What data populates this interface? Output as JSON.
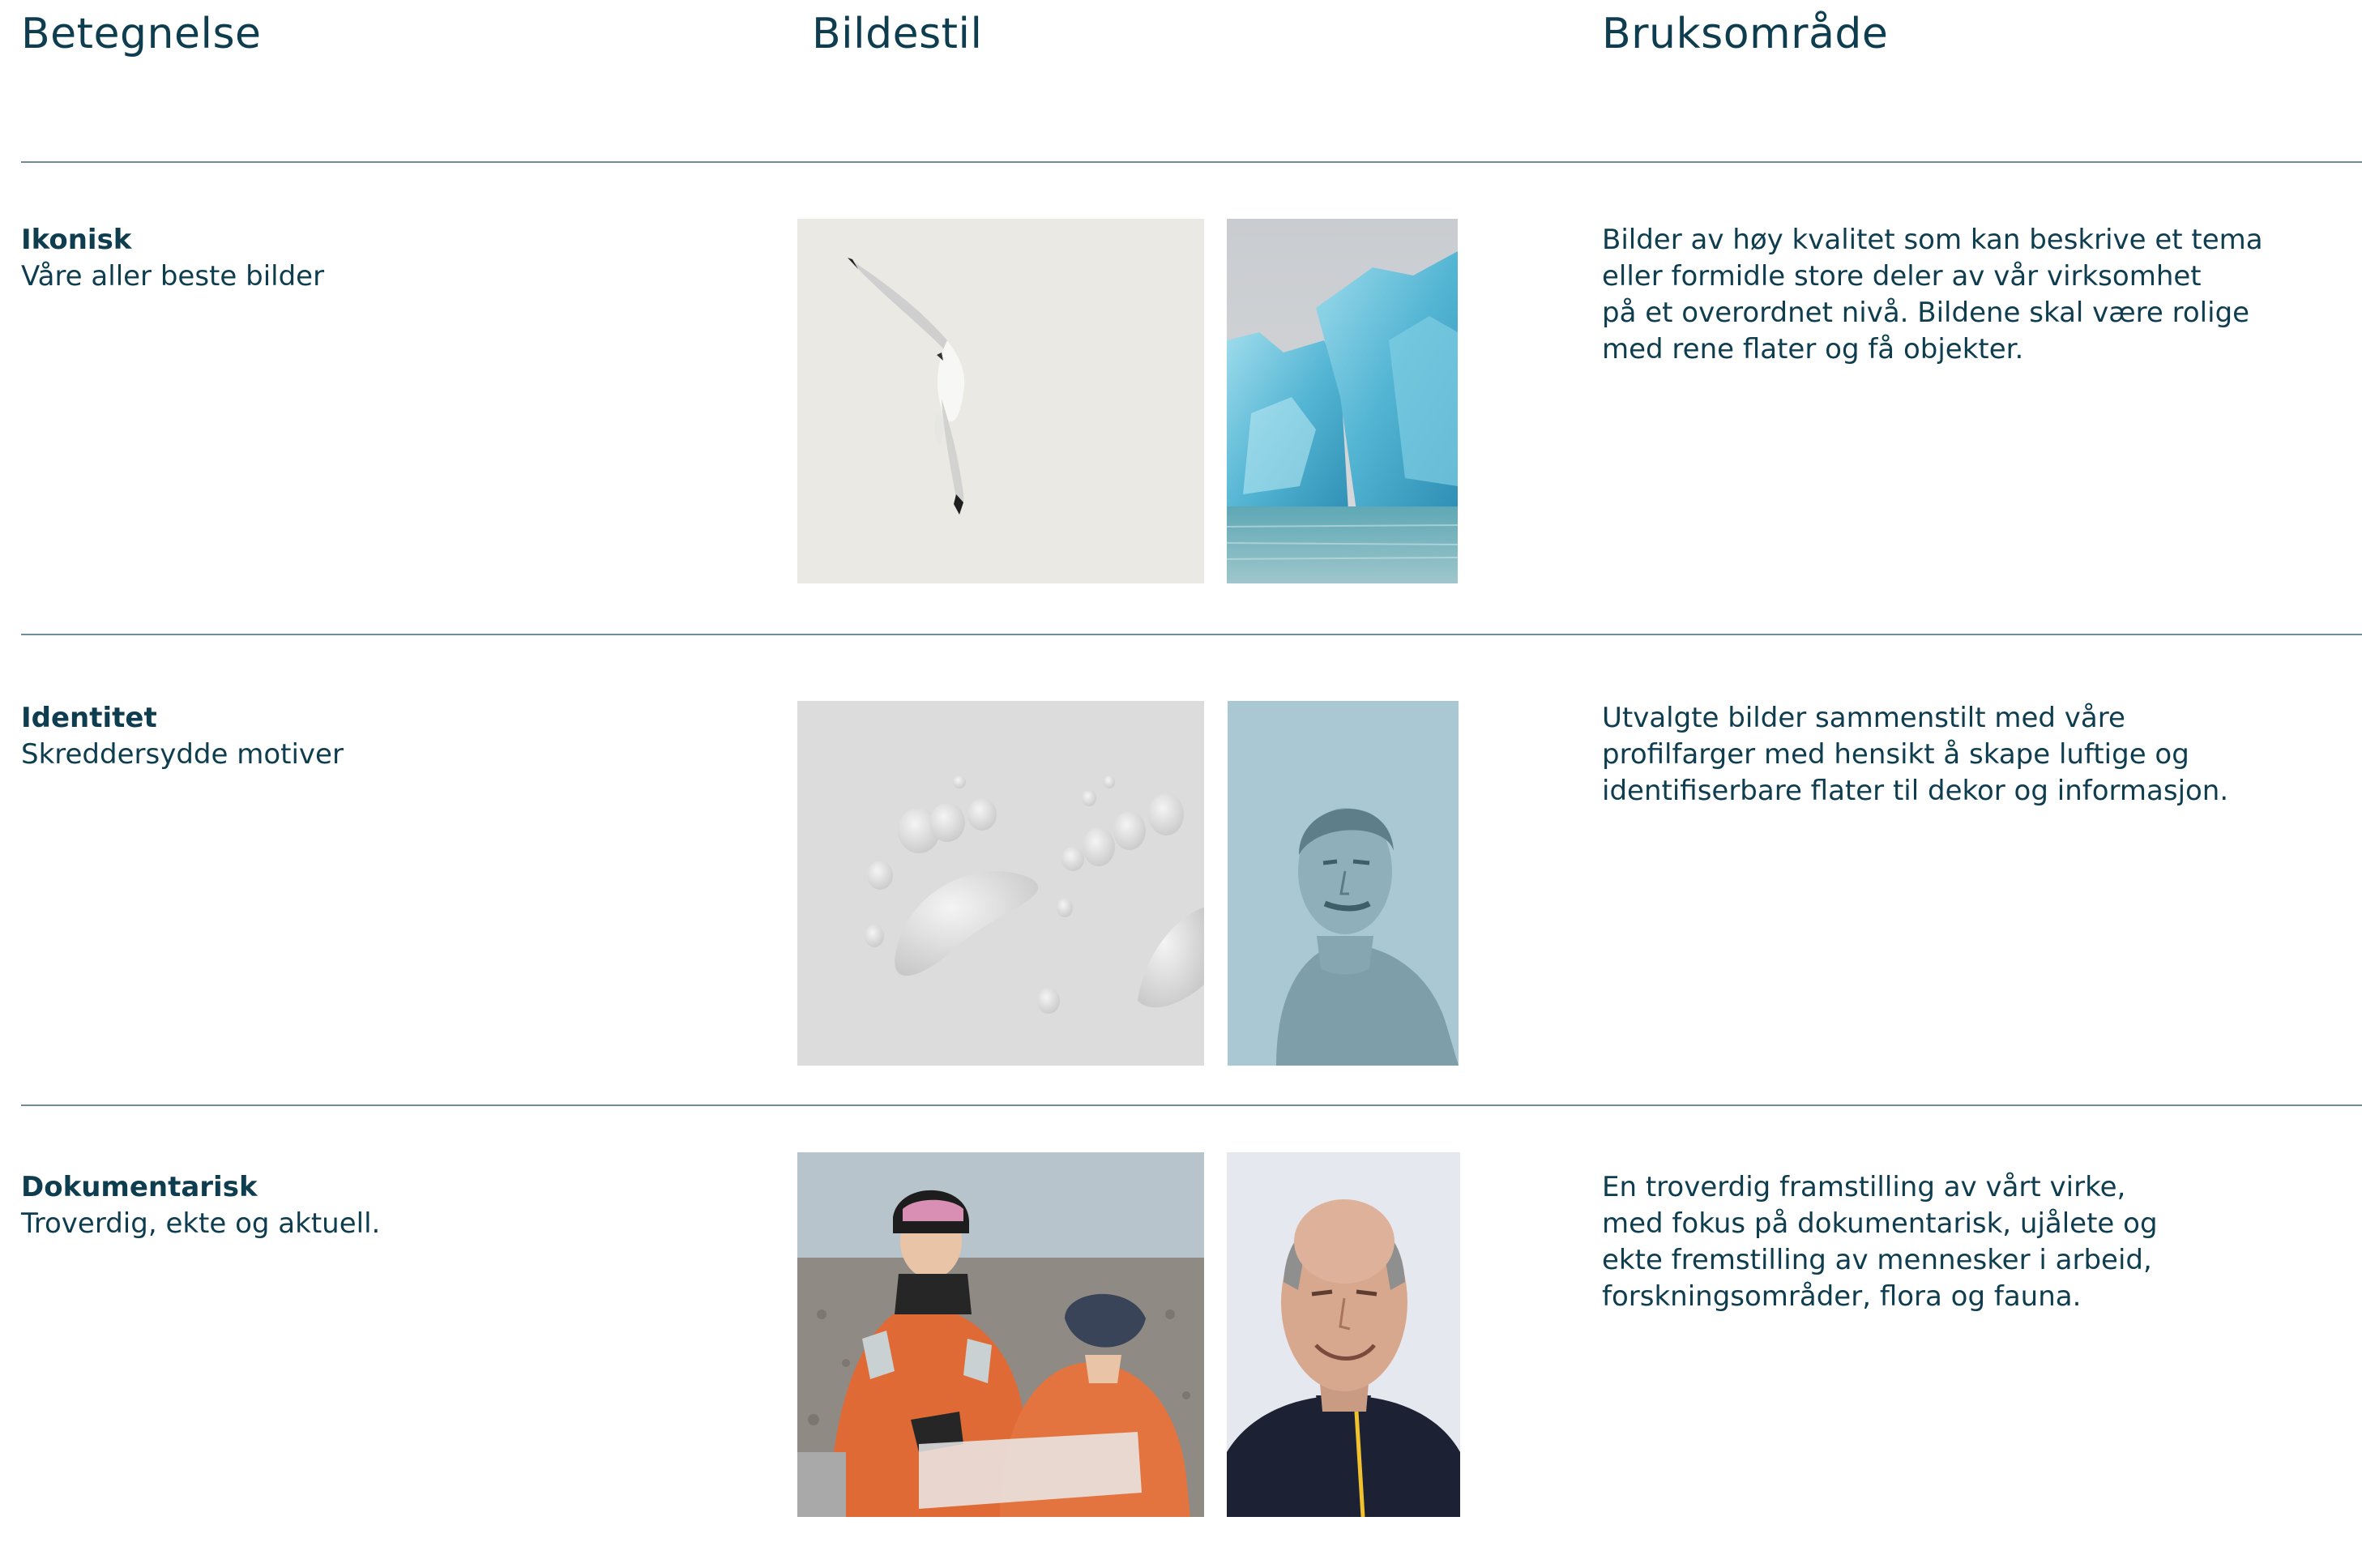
{
  "header": {
    "col1": "Betegnelse",
    "col2": "Bildestil",
    "col3": "Bruksområde"
  },
  "rows": [
    {
      "title": "Ikonisk",
      "subtitle": "Våre aller beste bilder",
      "description_lines": [
        "Bilder av høy kvalitet som kan beskrive et tema",
        "eller formidle store deler av vår virksomhet",
        "på et overordnet nivå. Bildene skal være rolige",
        "med rene flater og få objekter."
      ],
      "images": [
        "photo-seabird-in-flight",
        "photo-blue-iceberg"
      ]
    },
    {
      "title": "Identitet",
      "subtitle": "Skreddersydde motiver",
      "description_lines": [
        "Utvalgte bilder sammenstilt med våre",
        "profilfarger med hensikt å skape luftige og",
        "identifiserbare flater til dekor og informasjon."
      ],
      "images": [
        "photo-polar-bear-tracks-in-snow",
        "photo-tinted-historic-portrait"
      ]
    },
    {
      "title": "Dokumentarisk",
      "subtitle": "Troverdig, ekte og aktuell.",
      "description_lines": [
        "En troverdig framstilling av vårt virke,",
        "med fokus på dokumentarisk, ujålete og",
        "ekte fremstilling av mennesker i arbeid,",
        "forskningsområder, flora og fauna."
      ],
      "images": [
        "photo-researchers-in-orange-suits",
        "photo-portrait-smiling-man"
      ]
    }
  ],
  "colors": {
    "text": "#0e3d4f",
    "rule": "#6e8c9b",
    "identity_tint": "#a9c8d3"
  }
}
